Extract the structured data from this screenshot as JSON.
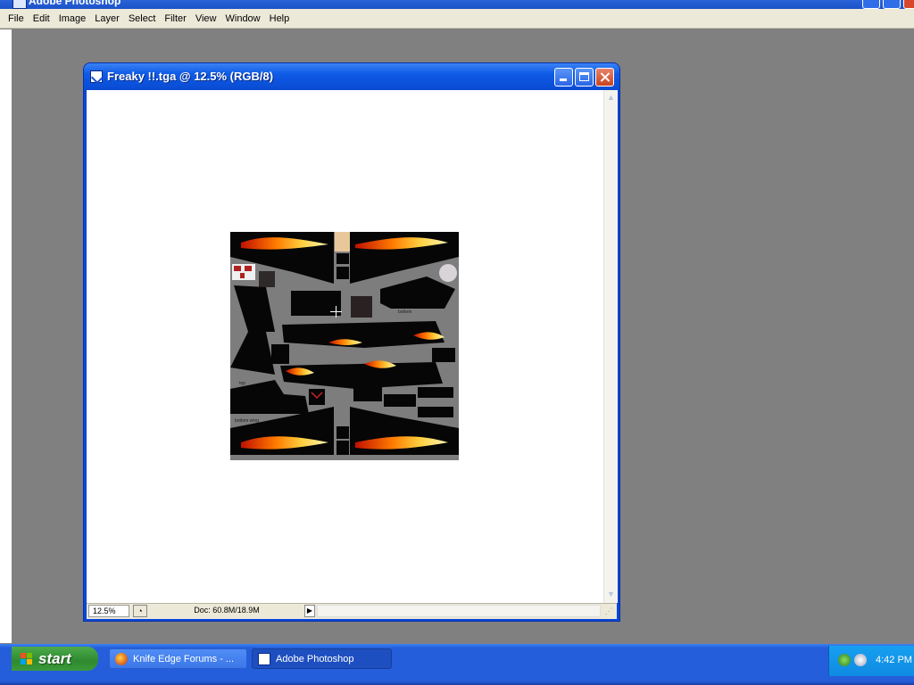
{
  "app": {
    "title": "Adobe Photoshop",
    "menu": [
      "File",
      "Edit",
      "Image",
      "Layer",
      "Select",
      "Filter",
      "View",
      "Window",
      "Help"
    ]
  },
  "document": {
    "title": "Freaky !!.tga @ 12.5% (RGB/8)",
    "zoom": "12.5%",
    "doc_info": "Doc: 60.8M/18.9M",
    "texture_labels": {
      "bottom": "bottom",
      "top": "top",
      "bottom_wing": "bottom wing"
    }
  },
  "taskbar": {
    "start_label": "start",
    "tasks": [
      {
        "label": "Knife Edge Forums - ..."
      },
      {
        "label": "Adobe Photoshop"
      }
    ],
    "clock": "4:42 PM"
  },
  "colors": {
    "xp_blue": "#0a4bd2",
    "menu_bg": "#ece9d8",
    "workspace": "#808080",
    "start_green": "#2f8a2f"
  }
}
